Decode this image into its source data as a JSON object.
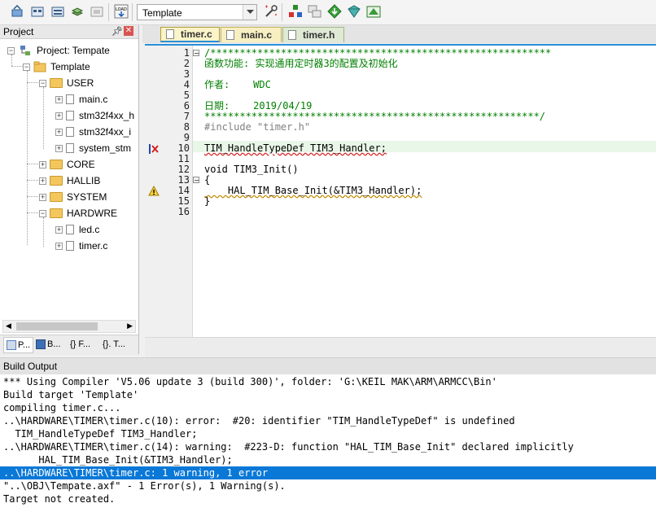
{
  "toolbar": {
    "target": "Template",
    "buttons": [
      "translate-icon",
      "build-icon",
      "rebuild-icon",
      "batch-build-icon",
      "stop-build-icon",
      "download-icon",
      "options-icon",
      "manage-components-icon",
      "manage-multi-project-icon",
      "pack-installer-icon",
      "select-packs-icon",
      "manage-rte-icon"
    ]
  },
  "project": {
    "title": "Project",
    "root": "Project: Tempate",
    "target": "Template",
    "groups": [
      {
        "name": "USER",
        "files": [
          "main.c",
          "stm32f4xx_h",
          "stm32f4xx_i",
          "system_stm"
        ]
      },
      {
        "name": "CORE",
        "files": []
      },
      {
        "name": "HALLIB",
        "files": []
      },
      {
        "name": "SYSTEM",
        "files": []
      },
      {
        "name": "HARDWRE",
        "files": [
          "led.c",
          "timer.c"
        ]
      }
    ],
    "bottom_tabs": [
      "P...",
      "B...",
      "{} F...",
      "{}. T..."
    ]
  },
  "editor": {
    "tabs": [
      "timer.c",
      "main.c",
      "timer.h"
    ],
    "active_tab": "timer.c",
    "lines": [
      {
        "n": "1",
        "text": "/**********************************************************",
        "cls": "cm",
        "fold": "-"
      },
      {
        "n": "2",
        "text": "函数功能: 实现通用定时器3的配置及初始化",
        "cls": "cm"
      },
      {
        "n": "3",
        "text": "",
        "cls": "cm"
      },
      {
        "n": "4",
        "text": "作者:    WDC",
        "cls": "cm"
      },
      {
        "n": "5",
        "text": "",
        "cls": "cm"
      },
      {
        "n": "6",
        "text": "日期:    2019/04/19",
        "cls": "cm"
      },
      {
        "n": "7",
        "text": "*********************************************************/",
        "cls": "cm"
      },
      {
        "n": "8",
        "text": "#include \"timer.h\"",
        "cls": "pp"
      },
      {
        "n": "9",
        "text": "",
        "cls": ""
      },
      {
        "n": "10",
        "text": "TIM_HandleTypeDef TIM3_Handler;",
        "cls": "",
        "marker": "error"
      },
      {
        "n": "11",
        "text": "",
        "cls": ""
      },
      {
        "n": "12",
        "text": "void TIM3_Init()",
        "cls": ""
      },
      {
        "n": "13",
        "text": "{",
        "cls": "",
        "fold": "-"
      },
      {
        "n": "14",
        "text": "    HAL_TIM_Base_Init(&TIM3_Handler);",
        "cls": "",
        "marker": "warning"
      },
      {
        "n": "15",
        "text": "}",
        "cls": ""
      },
      {
        "n": "16",
        "text": "",
        "cls": ""
      }
    ]
  },
  "build": {
    "title": "Build Output",
    "lines": [
      "*** Using Compiler 'V5.06 update 3 (build 300)', folder: 'G:\\KEIL MAK\\ARM\\ARMCC\\Bin'",
      "Build target 'Template'",
      "compiling timer.c...",
      "..\\HARDWARE\\TIMER\\timer.c(10): error:  #20: identifier \"TIM_HandleTypeDef\" is undefined",
      "  TIM_HandleTypeDef TIM3_Handler;",
      "..\\HARDWARE\\TIMER\\timer.c(14): warning:  #223-D: function \"HAL_TIM_Base_Init\" declared implicitly",
      "      HAL_TIM_Base_Init(&TIM3_Handler);",
      "..\\HARDWARE\\TIMER\\timer.c: 1 warning, 1 error",
      "\"..\\OBJ\\Tempate.axf\" - 1 Error(s), 1 Warning(s).",
      "Target not created."
    ],
    "selected_index": 7
  }
}
